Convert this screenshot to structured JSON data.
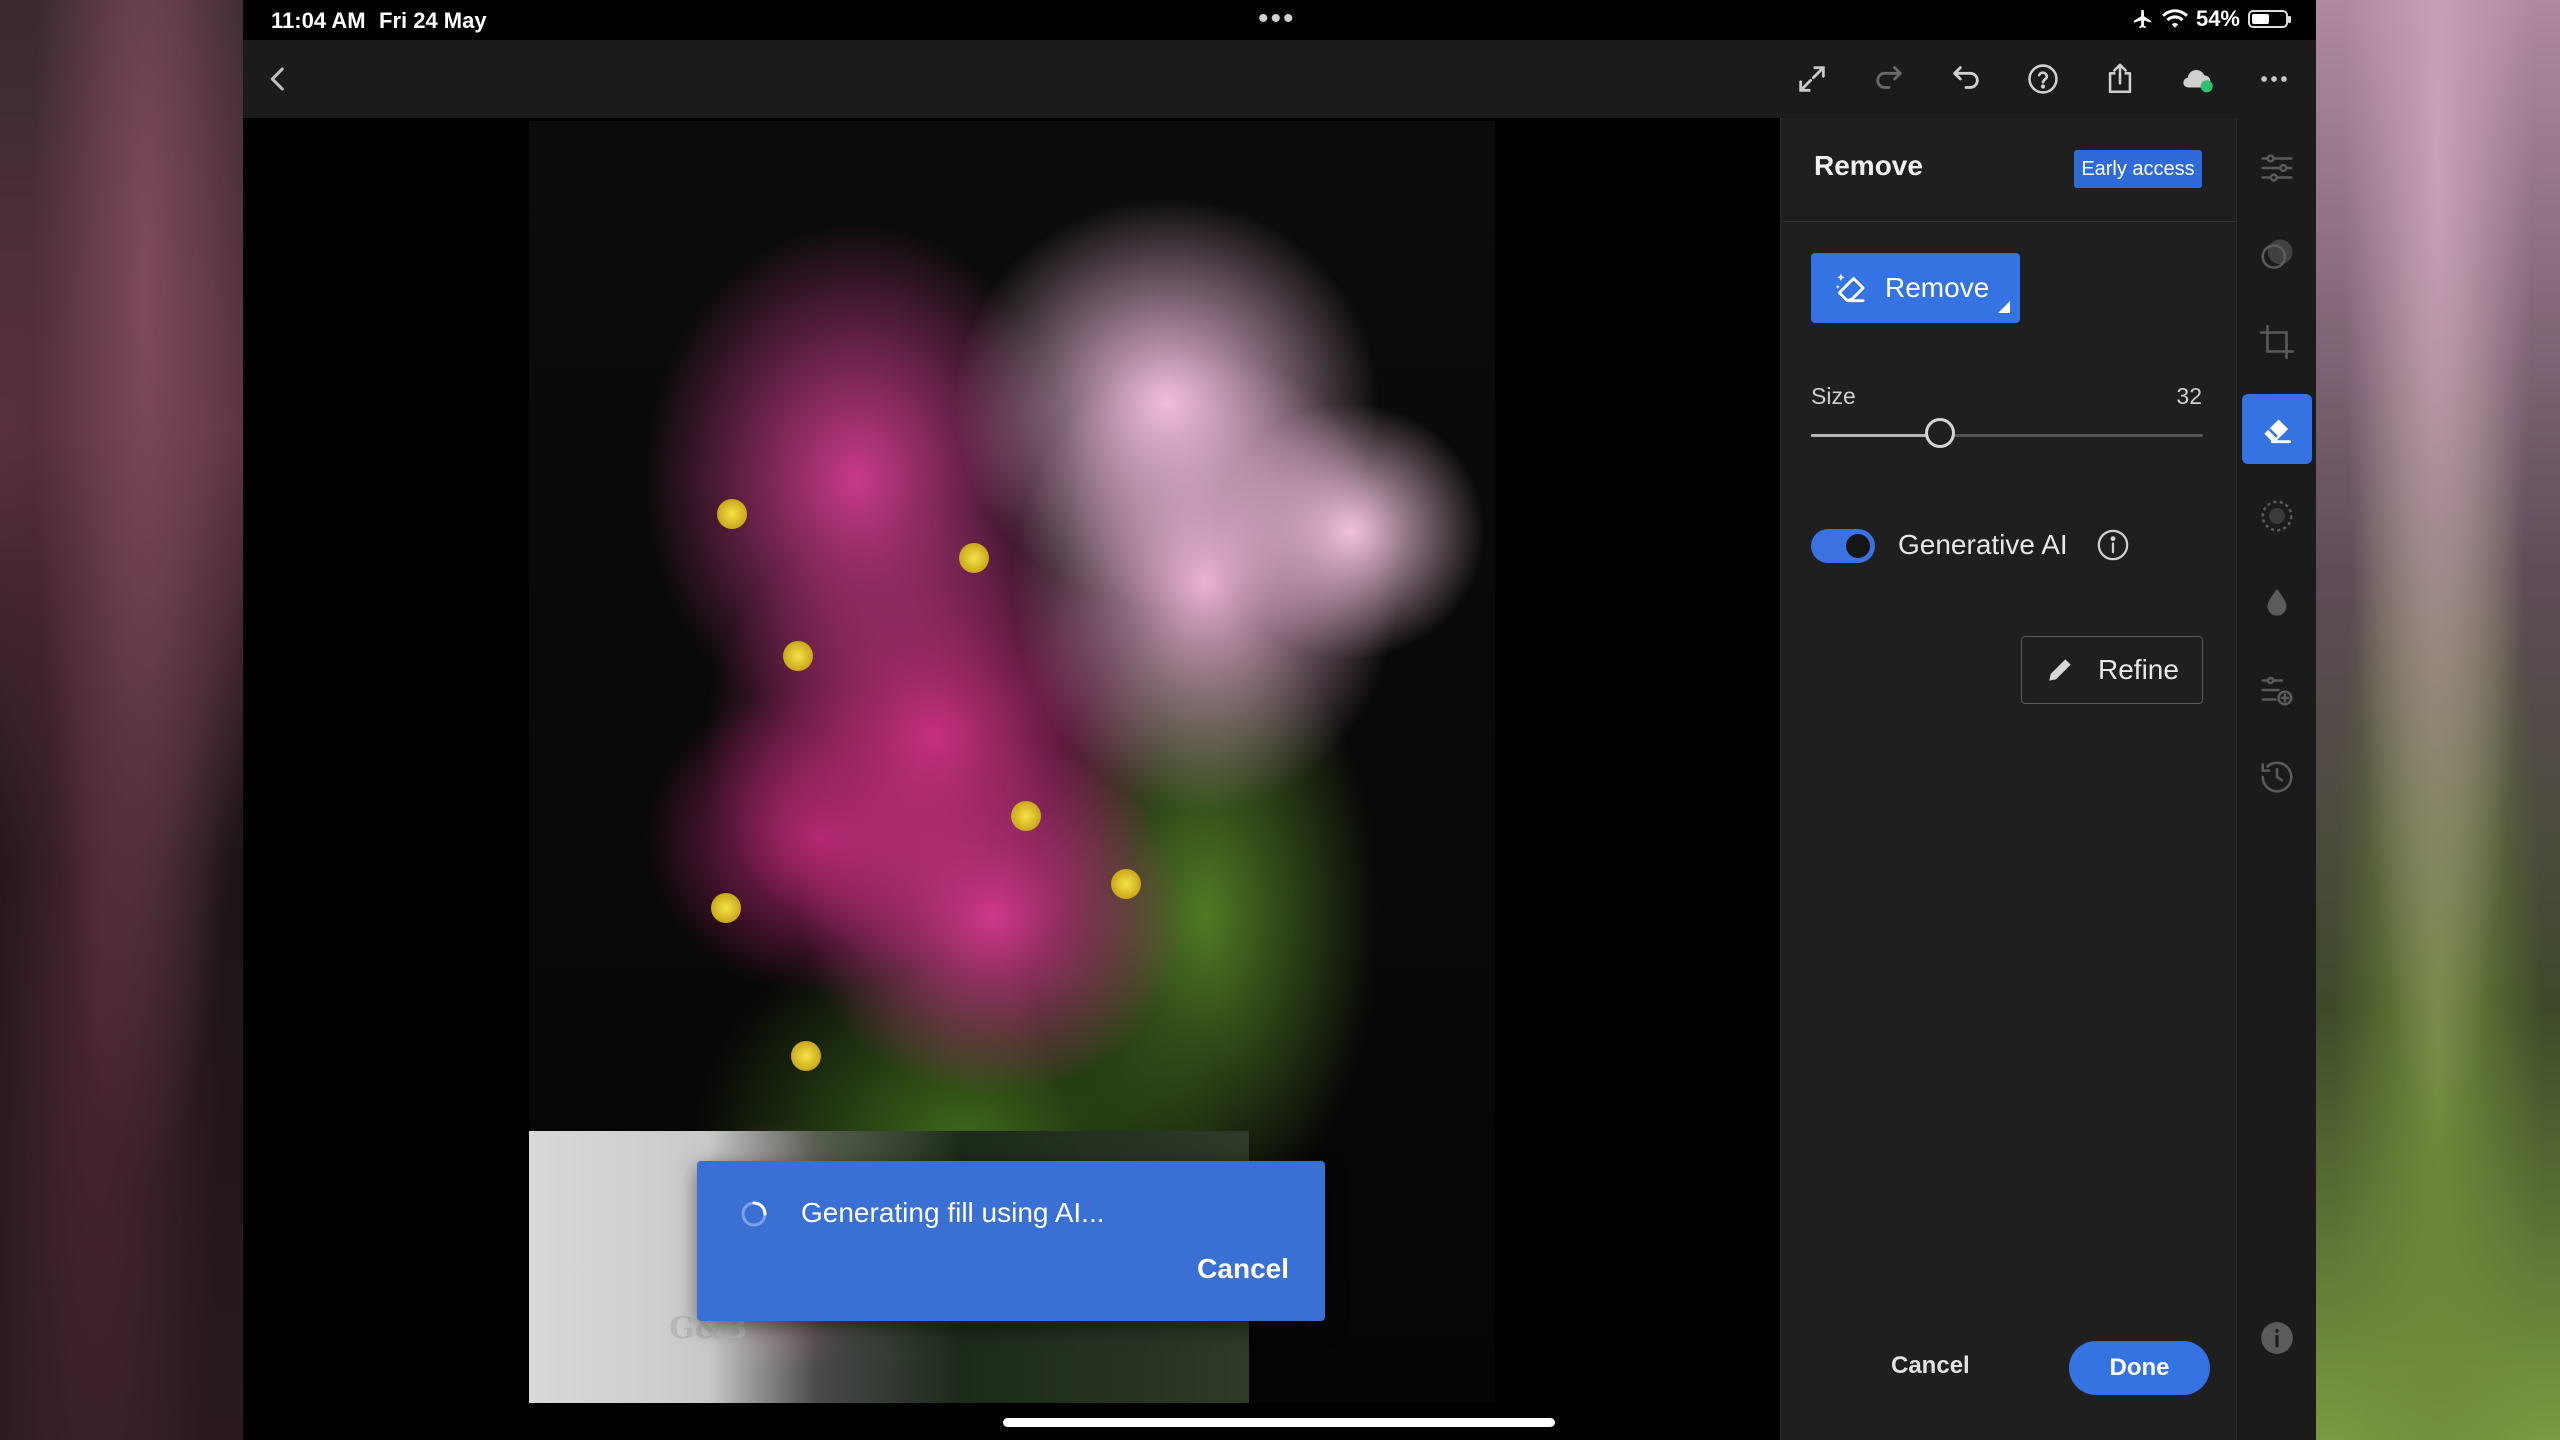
{
  "status_bar": {
    "time": "11:04 AM",
    "date": "Fri 24 May",
    "battery": "54%",
    "battery_level": 0.54
  },
  "toolbar": {
    "icons": [
      "back-chevron-icon",
      "fullscreen-icon",
      "redo-icon",
      "undo-icon",
      "help-icon",
      "share-icon",
      "cloud-sync-icon",
      "more-icon"
    ]
  },
  "toast": {
    "message": "Generating fill using AI...",
    "cancel_label": "Cancel"
  },
  "panel": {
    "title": "Remove",
    "badge": "Early access",
    "remove_button": "Remove",
    "size_label": "Size",
    "size_value": "32",
    "size_fraction": 0.33,
    "generative_ai_label": "Generative AI",
    "generative_ai_on": true,
    "refine_label": "Refine",
    "cancel_label": "Cancel",
    "done_label": "Done"
  },
  "photo": {
    "vase_logo": "G&B"
  },
  "rail": {
    "tools": [
      "edit-sliders-icon",
      "masking-icon",
      "crop-icon",
      "remove-eraser-icon",
      "blur-icon",
      "healing-drop-icon",
      "presets-icon",
      "versions-icon",
      "info-icon"
    ],
    "active": "remove-eraser-icon"
  },
  "colors": {
    "accent": "#3473e1",
    "panel_bg": "#1f1f1f",
    "toast_bg": "#3a6fd4"
  }
}
